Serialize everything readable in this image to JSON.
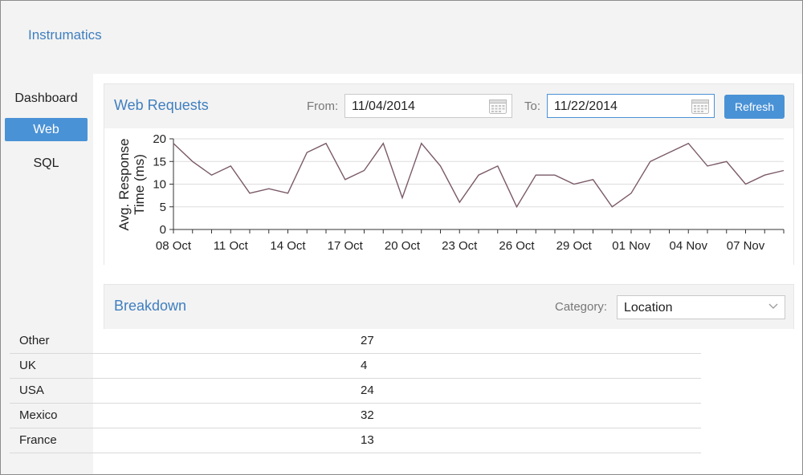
{
  "app": {
    "title": "Instrumatics"
  },
  "sidebar": {
    "items": [
      {
        "label": "Dashboard",
        "active": false
      },
      {
        "label": "Web",
        "active": true
      },
      {
        "label": "SQL",
        "active": false
      }
    ]
  },
  "web_requests": {
    "title": "Web Requests",
    "from_label": "From:",
    "from_value": "11/04/2014",
    "to_label": "To:",
    "to_value": "11/22/2014",
    "refresh_label": "Refresh",
    "line_color": "#7a5a68"
  },
  "chart_data": {
    "type": "line",
    "ylabel": "Avg. Response Time (ms)",
    "ylim": [
      0,
      20
    ],
    "yticks": [
      0,
      5,
      10,
      15,
      20
    ],
    "grid": true,
    "x_tick_labels": [
      "08 Oct",
      "11 Oct",
      "14 Oct",
      "17 Oct",
      "20 Oct",
      "23 Oct",
      "26 Oct",
      "29 Oct",
      "01 Nov",
      "04 Nov",
      "07 Nov"
    ],
    "x": [
      "08 Oct",
      "09 Oct",
      "10 Oct",
      "11 Oct",
      "12 Oct",
      "13 Oct",
      "14 Oct",
      "15 Oct",
      "16 Oct",
      "17 Oct",
      "18 Oct",
      "19 Oct",
      "20 Oct",
      "21 Oct",
      "22 Oct",
      "23 Oct",
      "24 Oct",
      "25 Oct",
      "26 Oct",
      "27 Oct",
      "28 Oct",
      "29 Oct",
      "30 Oct",
      "31 Oct",
      "01 Nov",
      "02 Nov",
      "03 Nov",
      "04 Nov",
      "05 Nov",
      "06 Nov",
      "07 Nov",
      "08 Nov",
      "09 Nov"
    ],
    "values": [
      19,
      15,
      12,
      14,
      8,
      9,
      8,
      17,
      19,
      11,
      13,
      19,
      7,
      19,
      14,
      6,
      12,
      14,
      5,
      12,
      12,
      10,
      11,
      5,
      8,
      15,
      17,
      19,
      14,
      15,
      10,
      12,
      13
    ]
  },
  "breakdown": {
    "title": "Breakdown",
    "category_label": "Category:",
    "category_value": "Location",
    "rows": [
      {
        "name": "Other",
        "value": "27"
      },
      {
        "name": "UK",
        "value": "4"
      },
      {
        "name": "USA",
        "value": "24"
      },
      {
        "name": "Mexico",
        "value": "32"
      },
      {
        "name": "France",
        "value": "13"
      }
    ]
  }
}
